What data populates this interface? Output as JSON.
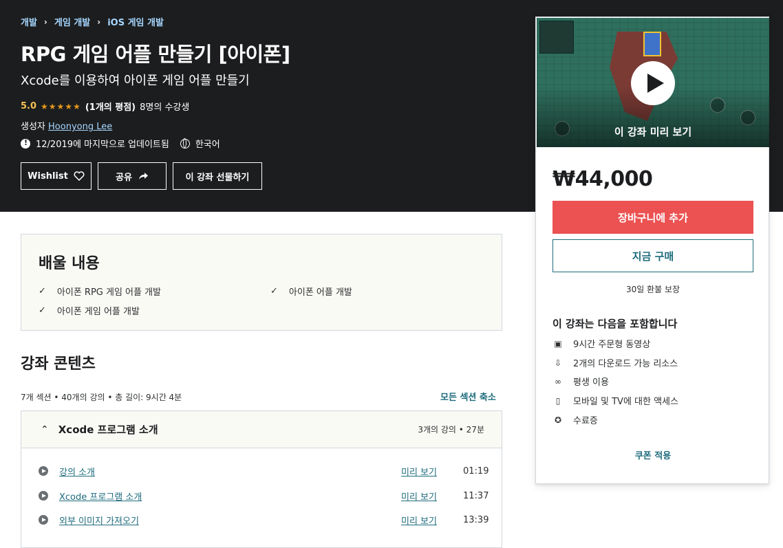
{
  "breadcrumb": [
    "개발",
    "게임 개발",
    "iOS 게임 개발"
  ],
  "course": {
    "title": "RPG 게임 어플 만들기 [아이폰]",
    "subtitle": "Xcode를 이용하여 아이폰 게임 어플 만들기",
    "rating": "5.0",
    "stars": "★★★★★",
    "rating_count": "(1개의 평점)",
    "students": "8명의 수강생",
    "creator_label": "생성자",
    "creator_name": "Hoonyong Lee",
    "updated": "12/2019에 마지막으로 업데이트됨",
    "language": "한국어"
  },
  "actions": {
    "wishlist": "Wishlist",
    "share": "공유",
    "gift": "이 강좌 선물하기"
  },
  "learn": {
    "title": "배울 내용",
    "items": [
      "아이폰 RPG 게임 어플 개발",
      "아이폰 어플 개발",
      "아이폰 게임 어플 개발"
    ]
  },
  "content": {
    "title": "강좌 콘텐츠",
    "meta": "7개 섹션 • 40개의 강의 • 총 길이: 9시간 4분",
    "collapse_all": "모든 섹션 축소",
    "section": {
      "title": "Xcode 프로그램 소개",
      "meta": "3개의 강의 • 27분",
      "lectures": [
        {
          "title": "강의 소개",
          "preview": "미리 보기",
          "duration": "01:19"
        },
        {
          "title": "Xcode 프로그램 소개",
          "preview": "미리 보기",
          "duration": "11:37"
        },
        {
          "title": "외부 이미지 가져오기",
          "preview": "미리 보기",
          "duration": "13:39"
        }
      ]
    }
  },
  "sidebar": {
    "preview_label": "이 강좌 미리 보기",
    "price": "₩44,000",
    "add_to_cart": "장바구니에 추가",
    "buy_now": "지금 구매",
    "guarantee": "30일 환불 보장",
    "includes_title": "이 강좌는 다음을 포함합니다",
    "includes": [
      {
        "icon": "video-icon",
        "label": "9시간 주문형 동영상"
      },
      {
        "icon": "download-icon",
        "label": "2개의 다운로드 가능 리소스"
      },
      {
        "icon": "infinity-icon",
        "label": "평생 이용"
      },
      {
        "icon": "mobile-icon",
        "label": "모바일 및 TV에 대한 액세스"
      },
      {
        "icon": "certificate-icon",
        "label": "수료증"
      }
    ],
    "coupon": "쿠폰 적용"
  },
  "colors": {
    "header_bg": "#1c1d1f",
    "accent": "#1e6b7c",
    "cart": "#ec5252",
    "star": "#e59819"
  }
}
